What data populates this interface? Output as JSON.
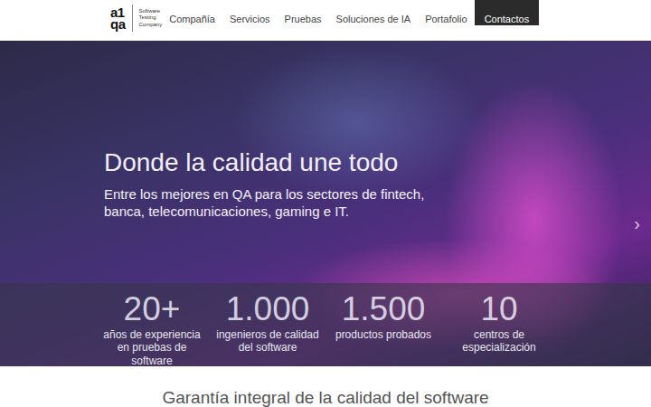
{
  "logo": {
    "mark_top": "a1",
    "mark_bottom": "qa",
    "tagline": [
      "Software",
      "Testing",
      "Company"
    ]
  },
  "nav": {
    "items": [
      {
        "label": "Compañía",
        "kind": "link"
      },
      {
        "label": "Servicios",
        "kind": "link"
      },
      {
        "label": "Pruebas",
        "kind": "link"
      },
      {
        "label": "Soluciones de IA",
        "kind": "link"
      },
      {
        "label": "Portafolio",
        "kind": "link"
      },
      {
        "label": "Contactos",
        "kind": "cta"
      }
    ]
  },
  "hero": {
    "title": "Donde la calidad une todo",
    "subtitle": "Entre los mejores en QA para los sectores de fintech, banca, telecomunicaciones, gaming e IT.",
    "next": "›"
  },
  "stats": [
    {
      "value": "20+",
      "label": "años de experiencia en pruebas de software"
    },
    {
      "value": "1.000",
      "label": "ingenieros de calidad del software"
    },
    {
      "value": "1.500",
      "label": "productos probados"
    },
    {
      "value": "10",
      "label": "centros de especialización"
    }
  ],
  "section": {
    "title": "Garantía integral de la calidad del software"
  }
}
